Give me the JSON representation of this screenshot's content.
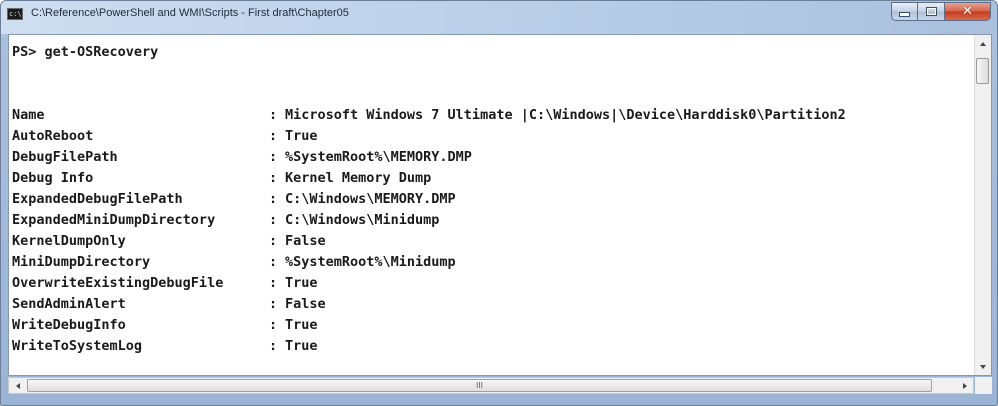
{
  "window": {
    "title": "C:\\Reference\\PowerShell and WMI\\Scripts - First draft\\Chapter05",
    "icon": "console-icon",
    "close_glyph": "✕"
  },
  "console": {
    "prompt": "PS> get-OSRecovery",
    "separator": ":",
    "rows": [
      {
        "label": "Name",
        "value": "Microsoft Windows 7 Ultimate |C:\\Windows|\\Device\\Harddisk0\\Partition2"
      },
      {
        "label": "AutoReboot",
        "value": "True"
      },
      {
        "label": "DebugFilePath",
        "value": "%SystemRoot%\\MEMORY.DMP"
      },
      {
        "label": "Debug Info",
        "value": "Kernel Memory Dump"
      },
      {
        "label": "ExpandedDebugFilePath",
        "value": "C:\\Windows\\MEMORY.DMP"
      },
      {
        "label": "ExpandedMiniDumpDirectory",
        "value": "C:\\Windows\\Minidump"
      },
      {
        "label": "KernelDumpOnly",
        "value": "False"
      },
      {
        "label": "MiniDumpDirectory",
        "value": "%SystemRoot%\\Minidump"
      },
      {
        "label": "OverwriteExistingDebugFile",
        "value": "True"
      },
      {
        "label": "SendAdminAlert",
        "value": "False"
      },
      {
        "label": "WriteDebugInfo",
        "value": "True"
      },
      {
        "label": "WriteToSystemLog",
        "value": "True"
      }
    ]
  },
  "scrollbar": {
    "h_grip": "III"
  },
  "colors": {
    "title_bar": "#bfd2ea",
    "close_button": "#c23b1d",
    "console_bg": "#ffffff",
    "console_text": "#1a1a1a"
  }
}
